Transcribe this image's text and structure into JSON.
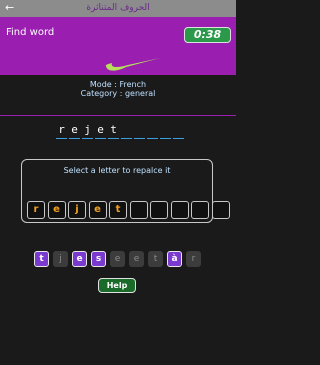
{
  "app_bar": {
    "title": "الحروف المتناثرة",
    "back_icon": "back-arrow-icon"
  },
  "header": {
    "title": "Find word",
    "timer": "0:38",
    "logo_icon": "swoosh-logo-icon"
  },
  "info": {
    "mode": "Mode : French",
    "category": "Category : general"
  },
  "word": {
    "letters": [
      "r",
      "e",
      "j",
      "e",
      "t",
      "",
      "",
      "",
      "",
      ""
    ]
  },
  "panel": {
    "instruction": "Select a letter to repalce it",
    "boxes": [
      "r",
      "e",
      "j",
      "e",
      "t",
      "",
      "",
      "",
      "",
      ""
    ]
  },
  "letters": [
    {
      "char": "t",
      "state": "selected"
    },
    {
      "char": "j",
      "state": "used"
    },
    {
      "char": "e",
      "state": "selected"
    },
    {
      "char": "s",
      "state": "selected"
    },
    {
      "char": "e",
      "state": "used"
    },
    {
      "char": "e",
      "state": "used"
    },
    {
      "char": "t",
      "state": "used"
    },
    {
      "char": "à",
      "state": "selected"
    },
    {
      "char": "r",
      "state": "used"
    }
  ],
  "help_label": "Help",
  "colors": {
    "accent": "#9a1fb0",
    "timer": "#2a9a4a",
    "selected_chip": "#7a3ad0",
    "box_letter": "#f0a020",
    "help": "#1a6a2a"
  }
}
